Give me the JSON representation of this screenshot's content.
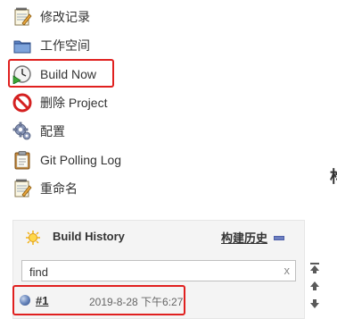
{
  "sidebar": {
    "items": [
      {
        "label": "修改记录"
      },
      {
        "label": "工作空间"
      },
      {
        "label": "Build Now"
      },
      {
        "label": "删除 Project"
      },
      {
        "label": "配置"
      },
      {
        "label": "Git Polling Log"
      },
      {
        "label": "重命名"
      }
    ]
  },
  "build_history": {
    "title": "Build History",
    "trend_link": "构建历史",
    "search": {
      "placeholder": "find",
      "value": "find",
      "clear_symbol": "x"
    },
    "builds": [
      {
        "number": "#1",
        "time": "2019-8-28 下午6:27",
        "status": "blue"
      }
    ]
  },
  "partial_text": "构",
  "colors": {
    "highlight": "#e0201f",
    "panel_bg": "#f4f4f4",
    "build_ball": "#4a6bb0"
  }
}
